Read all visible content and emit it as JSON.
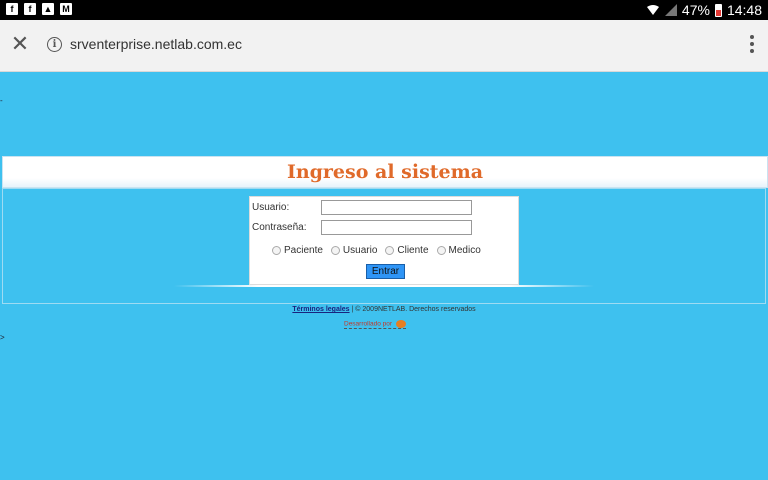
{
  "status_bar": {
    "battery": "47%",
    "time": "14:48",
    "left_icons": [
      "facebook-icon",
      "facebook-icon",
      "image-icon",
      "gmail-icon"
    ]
  },
  "browser": {
    "url": "srventerprise.netlab.com.ec"
  },
  "page": {
    "stray_top": "-",
    "stray_bottom": ">",
    "title": "Ingreso al sistema",
    "login": {
      "usuario_label": "Usuario:",
      "password_label": "Contraseña:",
      "radios": [
        "Paciente",
        "Usuario",
        "Cliente",
        "Medico"
      ],
      "submit_label": "Entrar"
    },
    "footer": {
      "terms_link": "Términos legales",
      "rights": "| © 2009NETLAB. Derechos reservados",
      "developed_by": "Desarrollado por"
    }
  },
  "colors": {
    "background": "#3ec1ef",
    "title": "#e06a2a",
    "button": "#2f95f6"
  }
}
